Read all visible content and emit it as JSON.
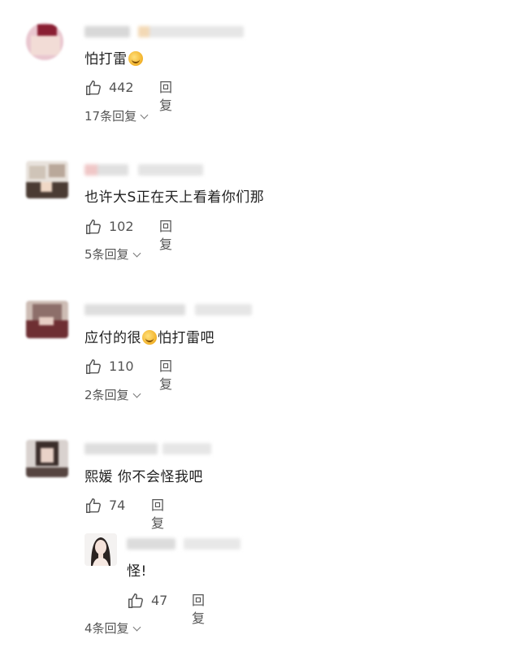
{
  "comments": [
    {
      "text_parts": [
        "怕打雷",
        ""
      ],
      "likes": "442",
      "reply_label": "回复",
      "replies_link": "17条回复"
    },
    {
      "text": "也许大S正在天上看着你们那",
      "likes": "102",
      "reply_label": "回复",
      "replies_link": "5条回复"
    },
    {
      "text_parts": [
        "应付的很",
        "怕打雷吧"
      ],
      "likes": "110",
      "reply_label": "回复",
      "replies_link": "2条回复"
    },
    {
      "text": "熙媛 你不会怪我吧",
      "likes": "74",
      "reply_label": "回复",
      "sub_reply": {
        "text": "怪!",
        "likes": "47",
        "reply_label": "回复"
      },
      "replies_link": "4条回复"
    }
  ],
  "icons": {
    "like": "thumbs-up-icon",
    "emoji": "crying-laughing-emoji",
    "expand": "chevron-down-icon"
  }
}
